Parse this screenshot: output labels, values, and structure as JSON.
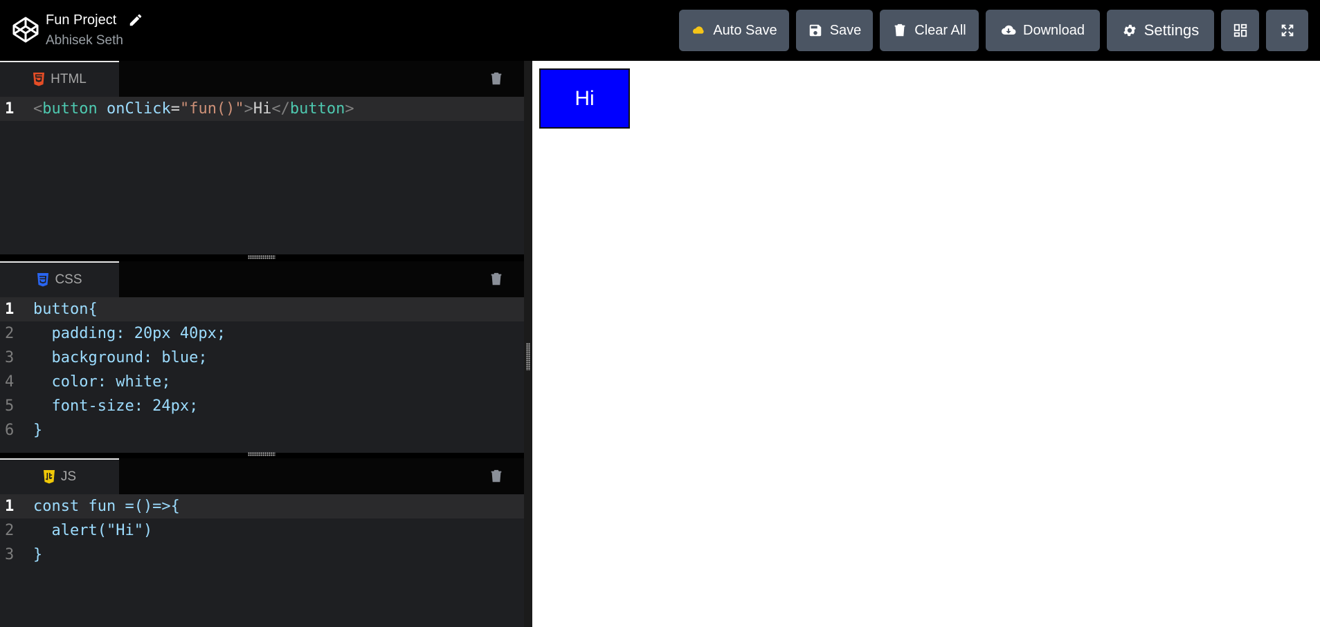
{
  "header": {
    "project_title": "Fun Project",
    "author": "Abhisek Seth",
    "buttons": {
      "auto_save": "Auto Save",
      "save": "Save",
      "clear_all": "Clear All",
      "download": "Download",
      "settings": "Settings"
    }
  },
  "panes": {
    "html": {
      "label": "HTML",
      "lines": [
        {
          "n": "1",
          "tokens": [
            {
              "t": "<",
              "c": "tk-ang"
            },
            {
              "t": "button",
              "c": "tk-tag"
            },
            {
              "t": " onClick",
              "c": "tk-attr"
            },
            {
              "t": "=",
              "c": "tk-eq"
            },
            {
              "t": "\"fun()\"",
              "c": "tk-str"
            },
            {
              "t": ">",
              "c": "tk-ang"
            },
            {
              "t": "Hi",
              "c": "tk-txt"
            },
            {
              "t": "</",
              "c": "tk-ang"
            },
            {
              "t": "button",
              "c": "tk-tag"
            },
            {
              "t": ">",
              "c": "tk-ang"
            }
          ]
        }
      ]
    },
    "css": {
      "label": "CSS",
      "lines": [
        {
          "n": "1",
          "text": "button{"
        },
        {
          "n": "2",
          "text": "  padding: 20px 40px;"
        },
        {
          "n": "3",
          "text": "  background: blue;"
        },
        {
          "n": "4",
          "text": "  color: white;"
        },
        {
          "n": "5",
          "text": "  font-size: 24px;"
        },
        {
          "n": "6",
          "text": "}"
        }
      ]
    },
    "js": {
      "label": "JS",
      "lines": [
        {
          "n": "1",
          "text": "const fun =()=>{"
        },
        {
          "n": "2",
          "text": "  alert(\"Hi\")"
        },
        {
          "n": "3",
          "text": "}"
        }
      ]
    }
  },
  "preview": {
    "button_label": "Hi",
    "button_color": "#0000ff"
  },
  "colors": {
    "html_icon": "#e44d26",
    "css_icon": "#2965f1",
    "js_icon": "#f0c808",
    "auto_save_icon": "#f5c518"
  }
}
